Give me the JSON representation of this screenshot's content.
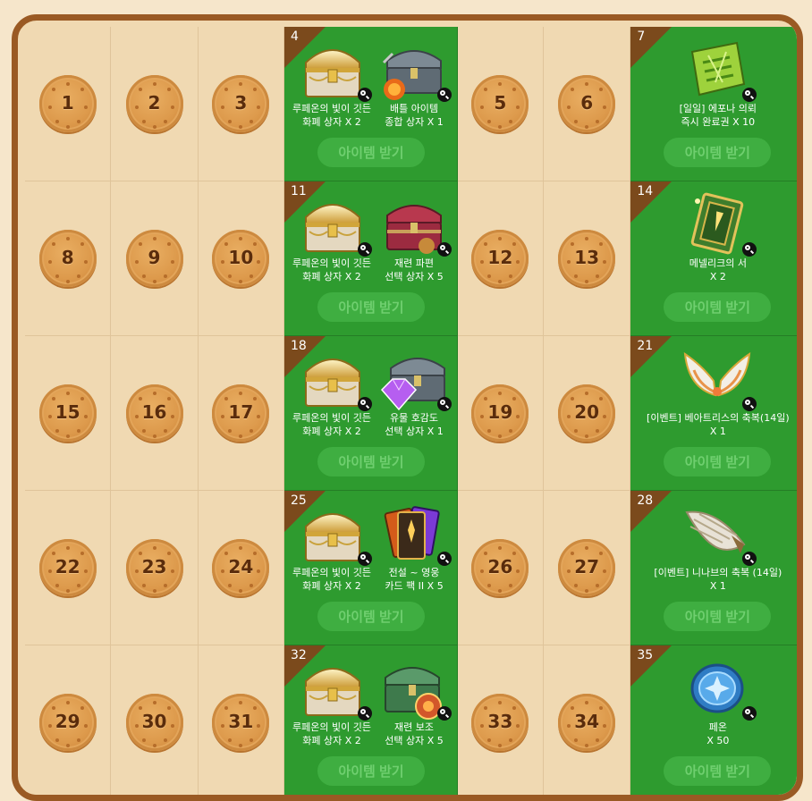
{
  "calendar": {
    "button_label": "아이템 받기",
    "rows": [
      {
        "days": [
          "1",
          "2",
          "3"
        ],
        "reward": {
          "day": "4",
          "type": "double",
          "items": [
            {
              "icon": "gold-treasure-chest-icon",
              "line1": "루페온의 빛이 깃든",
              "line2": "화폐 상자 X 2"
            },
            {
              "icon": "battle-item-chest-icon",
              "line1": "배틀 아이템",
              "line2": "종합 상자  X 1"
            }
          ]
        },
        "days2": [
          "5",
          "6"
        ],
        "reward2": {
          "day": "7",
          "type": "single",
          "items": [
            {
              "icon": "green-scroll-icon",
              "line1": "[일일] 에포나 의뢰",
              "line2": "즉시 완료권 X 10"
            }
          ]
        }
      },
      {
        "days": [
          "8",
          "9",
          "10"
        ],
        "reward": {
          "day": "11",
          "type": "double",
          "items": [
            {
              "icon": "gold-treasure-chest-icon",
              "line1": "루페온의 빛이 깃든",
              "line2": "화폐 상자 X 2"
            },
            {
              "icon": "red-chest-icon",
              "line1": "재련 파편",
              "line2": "선택 상자 X 5"
            }
          ]
        },
        "days2": [
          "12",
          "13"
        ],
        "reward2": {
          "day": "14",
          "type": "single",
          "items": [
            {
              "icon": "green-book-icon",
              "line1": "메넬리크의 서",
              "line2": "X 2"
            }
          ]
        }
      },
      {
        "days": [
          "15",
          "16",
          "17"
        ],
        "reward": {
          "day": "18",
          "type": "double",
          "items": [
            {
              "icon": "gold-treasure-chest-icon",
              "line1": "루페온의 빛이 깃든",
              "line2": "화폐 상자 X 2"
            },
            {
              "icon": "gem-chest-icon",
              "line1": "유물 호감도",
              "line2": "선택 상자 X 1"
            }
          ]
        },
        "days2": [
          "19",
          "20"
        ],
        "reward2": {
          "day": "21",
          "type": "single",
          "items": [
            {
              "icon": "wings-icon",
              "line1": "[이벤트] 베아트리스의 축복(14일)",
              "line2": "X 1"
            }
          ]
        }
      },
      {
        "days": [
          "22",
          "23",
          "24"
        ],
        "reward": {
          "day": "25",
          "type": "double",
          "items": [
            {
              "icon": "gold-treasure-chest-icon",
              "line1": "루페온의 빛이 깃든",
              "line2": "화폐 상자 X 2"
            },
            {
              "icon": "card-pack-icon",
              "line1": "전설 ~ 영웅",
              "line2": "카드 팩 II X 5"
            }
          ]
        },
        "days2": [
          "26",
          "27"
        ],
        "reward2": {
          "day": "28",
          "type": "single",
          "items": [
            {
              "icon": "feather-wing-icon",
              "line1": "[이벤트] 니나브의 축복 (14일)",
              "line2": "X 1"
            }
          ]
        }
      },
      {
        "days": [
          "29",
          "30",
          "31"
        ],
        "reward": {
          "day": "32",
          "type": "double",
          "items": [
            {
              "icon": "gold-treasure-chest-icon",
              "line1": "루페온의 빛이 깃든",
              "line2": "화폐 상자 X 2"
            },
            {
              "icon": "green-chest-icon",
              "line1": "재련 보조",
              "line2": "선택 상자 X 5"
            }
          ]
        },
        "days2": [
          "33",
          "34"
        ],
        "reward2": {
          "day": "35",
          "type": "single",
          "items": [
            {
              "icon": "blue-coin-icon",
              "line1": "페온",
              "line2": "X 50"
            }
          ]
        }
      }
    ]
  }
}
